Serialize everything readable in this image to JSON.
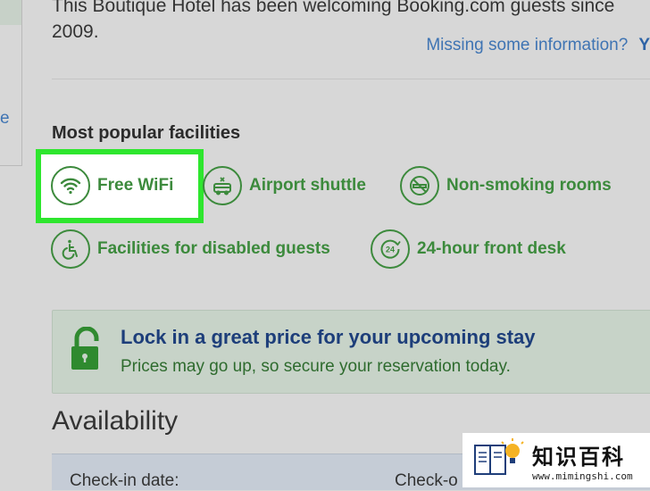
{
  "intro": {
    "line1": "This Boutique Hotel has been welcoming Booking.com guests since",
    "line2": "2009."
  },
  "missing_info": {
    "text": "Missing some information?",
    "link": "Y"
  },
  "sidebar": {
    "letter": "e"
  },
  "facilities": {
    "title": "Most popular facilities",
    "items": [
      {
        "label": "Free WiFi",
        "icon": "wifi-icon"
      },
      {
        "label": "Airport shuttle",
        "icon": "airport-shuttle-icon"
      },
      {
        "label": "Non-smoking rooms",
        "icon": "no-smoking-icon"
      },
      {
        "label": "Facilities for disabled guests",
        "icon": "wheelchair-icon"
      },
      {
        "label": "24-hour front desk",
        "icon": "24-hour-icon"
      }
    ],
    "highlight_color": "#2ee62e",
    "accent_color": "#3c8a3c"
  },
  "promo": {
    "title": "Lock in a great price for your upcoming stay",
    "subtitle": "Prices may go up, so secure your reservation today.",
    "icon": "unlocked-padlock-icon"
  },
  "availability": {
    "title": "Availability",
    "checkin_label": "Check-in date:",
    "checkout_label": "Check-o"
  },
  "watermark": {
    "main": "知识百科",
    "url": "www.mimingshi.com",
    "icon": "book-lightbulb-icon"
  }
}
